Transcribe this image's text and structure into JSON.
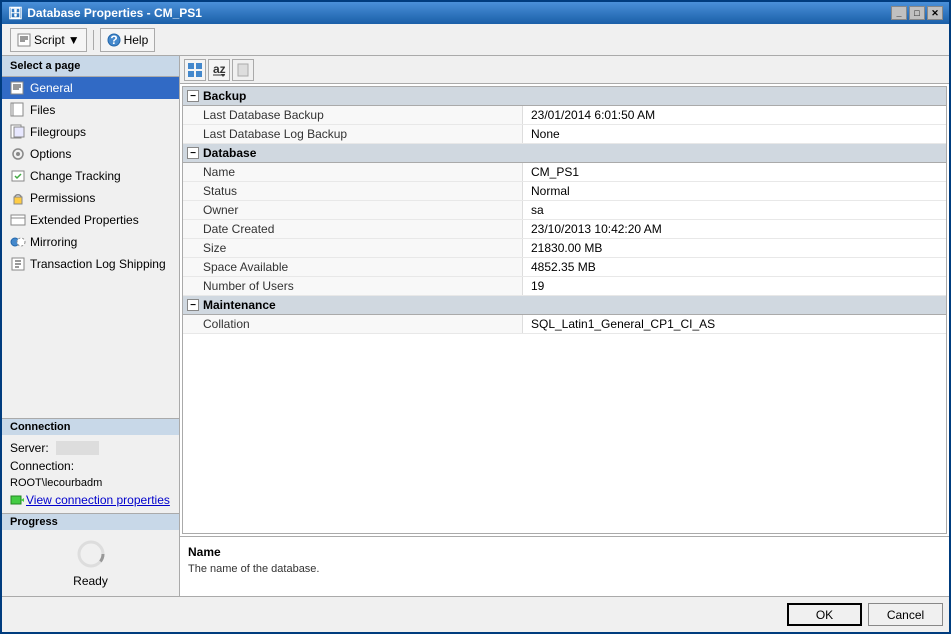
{
  "window": {
    "title": "Database Properties - CM_PS1",
    "icon": "🗄"
  },
  "toolbar": {
    "script_label": "Script",
    "help_label": "Help"
  },
  "sidebar": {
    "header": "Select a page",
    "items": [
      {
        "id": "general",
        "label": "General",
        "active": true
      },
      {
        "id": "files",
        "label": "Files",
        "active": false
      },
      {
        "id": "filegroups",
        "label": "Filegroups",
        "active": false
      },
      {
        "id": "options",
        "label": "Options",
        "active": false
      },
      {
        "id": "change-tracking",
        "label": "Change Tracking",
        "active": false
      },
      {
        "id": "permissions",
        "label": "Permissions",
        "active": false
      },
      {
        "id": "extended-properties",
        "label": "Extended Properties",
        "active": false
      },
      {
        "id": "mirroring",
        "label": "Mirroring",
        "active": false
      },
      {
        "id": "transaction-log",
        "label": "Transaction Log Shipping",
        "active": false
      }
    ]
  },
  "connection": {
    "header": "Connection",
    "server_label": "Server:",
    "server_value": "──────",
    "connection_label": "Connection:",
    "connection_value": "ROOT\\lecourbadm",
    "link_label": "View connection properties"
  },
  "progress": {
    "header": "Progress",
    "status": "Ready"
  },
  "properties": {
    "sections": [
      {
        "id": "backup",
        "title": "Backup",
        "expanded": true,
        "rows": [
          {
            "name": "Last Database Backup",
            "value": "23/01/2014 6:01:50 AM"
          },
          {
            "name": "Last Database Log Backup",
            "value": "None"
          }
        ]
      },
      {
        "id": "database",
        "title": "Database",
        "expanded": true,
        "rows": [
          {
            "name": "Name",
            "value": "CM_PS1"
          },
          {
            "name": "Status",
            "value": "Normal"
          },
          {
            "name": "Owner",
            "value": "sa"
          },
          {
            "name": "Date Created",
            "value": "23/10/2013 10:42:20 AM"
          },
          {
            "name": "Size",
            "value": "21830.00 MB"
          },
          {
            "name": "Space Available",
            "value": "4852.35 MB"
          },
          {
            "name": "Number of Users",
            "value": "19"
          }
        ]
      },
      {
        "id": "maintenance",
        "title": "Maintenance",
        "expanded": true,
        "rows": [
          {
            "name": "Collation",
            "value": "SQL_Latin1_General_CP1_CI_AS"
          }
        ]
      }
    ]
  },
  "description": {
    "title": "Name",
    "text": "The name of the database."
  },
  "buttons": {
    "ok": "OK",
    "cancel": "Cancel"
  }
}
